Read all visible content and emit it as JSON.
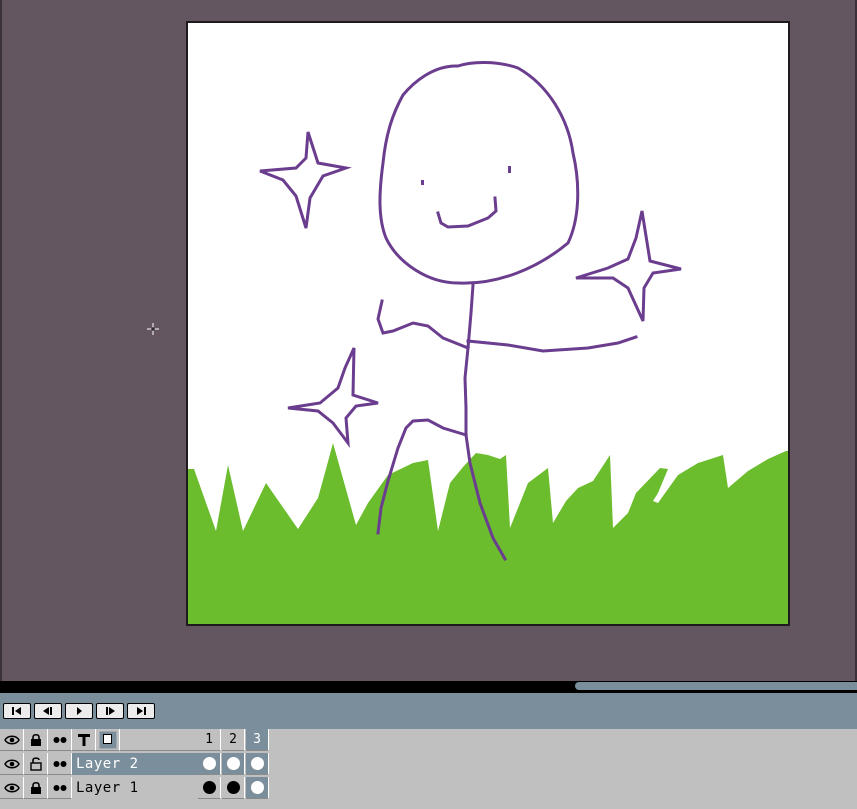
{
  "colors": {
    "workspace": "#645660",
    "canvas": "#ffffff",
    "stroke": "#6b3d8e",
    "grass": "#6cbd2e",
    "panel": "#7a8e9c",
    "timeline": "#c0c0c0"
  },
  "transport": {
    "buttons": [
      {
        "name": "first-frame-icon"
      },
      {
        "name": "previous-frame-icon"
      },
      {
        "name": "play-icon"
      },
      {
        "name": "next-frame-icon"
      },
      {
        "name": "last-frame-icon"
      }
    ]
  },
  "timeline": {
    "header_icons": [
      "eye-icon",
      "lock-icon",
      "onion-skin-icon",
      "text-tool-icon",
      "layer-thumbnail-icon"
    ],
    "frames": [
      "1",
      "2",
      "3"
    ],
    "current_frame": "3",
    "layers": [
      {
        "name": "Layer 2",
        "selected": true,
        "locked": false,
        "cels": [
          "empty",
          "empty",
          "empty"
        ]
      },
      {
        "name": "Layer 1",
        "selected": false,
        "locked": true,
        "cels": [
          "filled",
          "filled",
          "empty"
        ]
      }
    ]
  }
}
